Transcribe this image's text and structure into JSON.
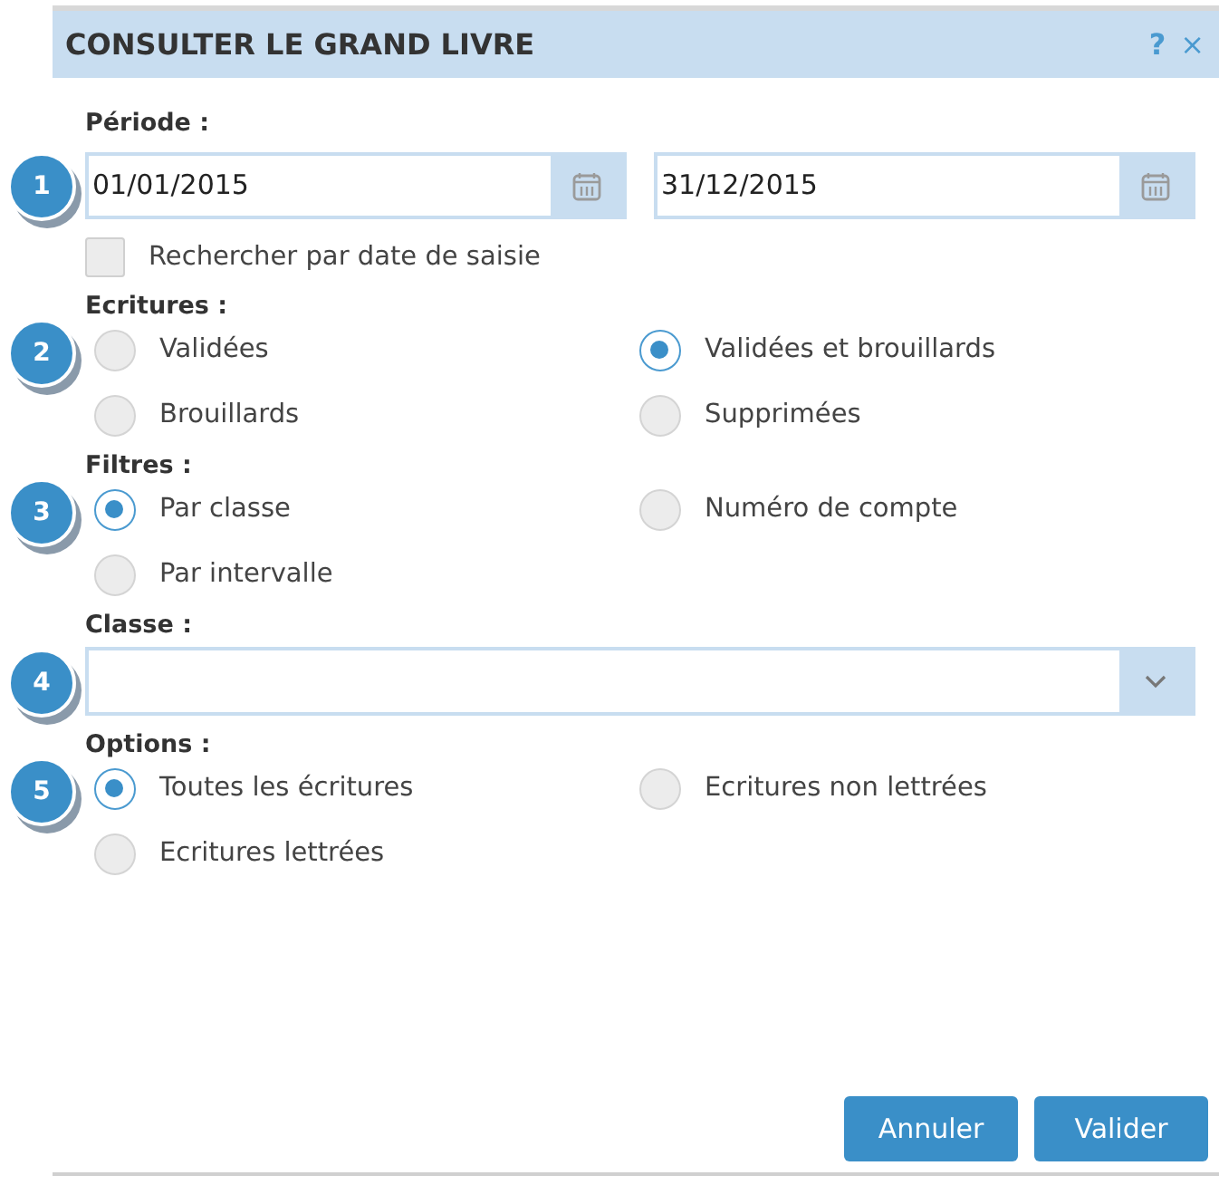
{
  "dialog": {
    "title": "CONSULTER LE GRAND LIVRE",
    "help": "?",
    "close": "×"
  },
  "periode": {
    "badge": "1",
    "label": "Période :",
    "start": "01/01/2015",
    "end": "31/12/2015",
    "entry_date": {
      "label": "Rechercher par date de saisie",
      "checked": false
    }
  },
  "ecritures": {
    "badge": "2",
    "label": "Ecritures :",
    "options": [
      {
        "label": "Validées",
        "selected": false
      },
      {
        "label": "Validées et brouillards",
        "selected": true
      },
      {
        "label": "Brouillards",
        "selected": false
      },
      {
        "label": "Supprimées",
        "selected": false
      }
    ]
  },
  "filtres": {
    "badge": "3",
    "label": "Filtres :",
    "options": [
      {
        "label": "Par classe",
        "selected": true
      },
      {
        "label": "Numéro de compte",
        "selected": false
      },
      {
        "label": "Par intervalle",
        "selected": false
      }
    ]
  },
  "classe": {
    "badge": "4",
    "label": "Classe :"
  },
  "options": {
    "badge": "5",
    "label": "Options :",
    "options": [
      {
        "label": "Toutes les écritures",
        "selected": true
      },
      {
        "label": "Ecritures non lettrées",
        "selected": false
      },
      {
        "label": "Ecritures lettrées",
        "selected": false
      }
    ]
  },
  "buttons": [
    "Annuler",
    "Valider"
  ]
}
